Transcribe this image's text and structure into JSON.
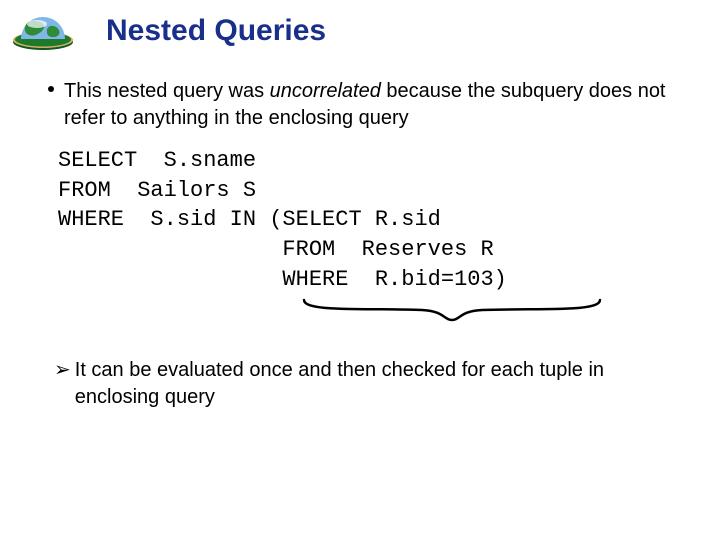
{
  "title": "Nested Queries",
  "bullet": {
    "pre": "This nested query was ",
    "em": "uncorrelated",
    "post": " because the subquery does not refer to anything in the enclosing query"
  },
  "code": {
    "l1": "SELECT  S.sname",
    "l2": "FROM  Sailors S",
    "l3": "WHERE  S.sid IN (SELECT R.sid",
    "l4": "                 FROM  Reserves R",
    "l5": "                 WHERE  R.bid=103)"
  },
  "arrow_note": "It can be evaluated once and then checked for each tuple in enclosing query",
  "glyphs": {
    "arrow": "➢"
  }
}
